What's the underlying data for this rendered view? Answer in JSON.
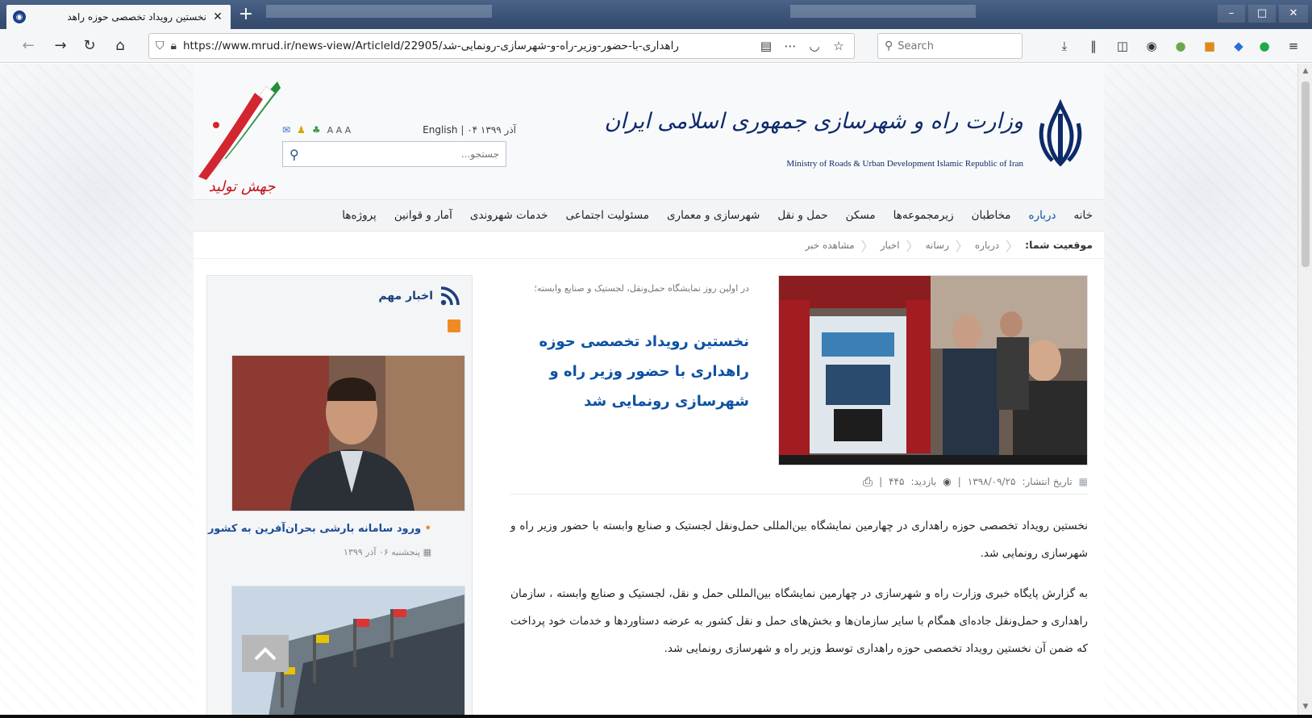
{
  "browser": {
    "tab_title": "نخستین رویداد تخصصی حوزه راهد",
    "url": "https://www.mrud.ir/news-view/ArticleId/22905/راهداری-با-حضور-وزیر-راه-و-شهرسازی-رونمایی-شد",
    "search_placeholder": "Search"
  },
  "header": {
    "brand_fa": "وزارت راه و شهرسازی جمهوری اسلامی ایران",
    "brand_en": "Ministry of Roads & Urban Development Islamic Republic of Iran",
    "date": "۰۴ آذر ۱۳۹۹",
    "lang_link": "English",
    "font_sizes": "A A A",
    "search_placeholder": "جستجو..."
  },
  "nav": {
    "items": [
      "خانه",
      "درباره",
      "مخاطبان",
      "زیرمجموعه‌ها",
      "مسکن",
      "حمل و نقل",
      "شهرسازی و معماری",
      "مسئولیت اجتماعی",
      "خدمات شهروندی",
      "آمار و قوانین",
      "پروژه‌ها"
    ]
  },
  "breadcrumb": {
    "lead": "موقعیت شما:",
    "items": [
      "درباره",
      "رسانه",
      "اخبار",
      "مشاهده خبر"
    ]
  },
  "article": {
    "kicker": "در اولین روز نمایشگاه حمل‌ونقل، لجستیک و صنایع وابسته؛",
    "headline": "نخستین رویداد تخصصی حوزه راهداری با حضور وزیر راه و شهرسازی رونمایی شد",
    "date_label": "تاریخ انتشار:",
    "date": "۱۳۹۸/۰۹/۲۵",
    "visits_label": "بازدید:",
    "visits": "۴۴۵",
    "paragraph1": "نخستین رویداد تخصصی حوزه راهداری در چهارمین نمایشگاه بین‌المللی حمل‌ونقل لجستیک و صنایع وابسته با حضور وزیر راه و شهرسازی رونمایی شد.",
    "paragraph2": "به گزارش  پایگاه خبری وزارت راه و شهرسازی در چهارمین نمایشگاه بین‌المللی حمل و نقل، لجستیک و صنایع وابسته ، سازمان راهداری و حمل‌ونقل جاده‌ای همگام با سایر سازمان‌ها و بخش‌های حمل و نقل کشور به عرضه دستاوردها و خدمات خود پرداخت که ضمن آن نخستین رویداد تخصصی حوزه راهداری توسط وزیر راه و شهرسازی رونمایی شد."
  },
  "sidebar": {
    "heading": "اخبار مهم",
    "news": [
      {
        "title": "ورود سامانه بارشی بحران‌آفرین به کشور",
        "date": "پنجشنبه ۰۶ آذر ۱۳۹۹"
      }
    ]
  },
  "slogan": "جهش تولید"
}
